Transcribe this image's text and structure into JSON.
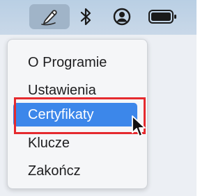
{
  "menubar": {
    "items": [
      {
        "icon": "pencil-icon",
        "active": true
      },
      {
        "icon": "bluetooth-icon"
      },
      {
        "icon": "user-account-icon"
      },
      {
        "icon": "battery-icon"
      }
    ],
    "highlight_color": "#a0b4c8"
  },
  "menu": {
    "items": [
      {
        "label": "O Programie"
      },
      {
        "label": "Ustawienia"
      },
      {
        "label": "Certyfikaty",
        "highlighted": true
      },
      {
        "label": "Klucze"
      },
      {
        "label": "Zakończ"
      }
    ],
    "highlight_color": "#3c87ea"
  },
  "annotation": {
    "color": "#e52a2e",
    "target": "Certyfikaty"
  },
  "cursor": {
    "icon": "arrow-cursor-icon"
  }
}
